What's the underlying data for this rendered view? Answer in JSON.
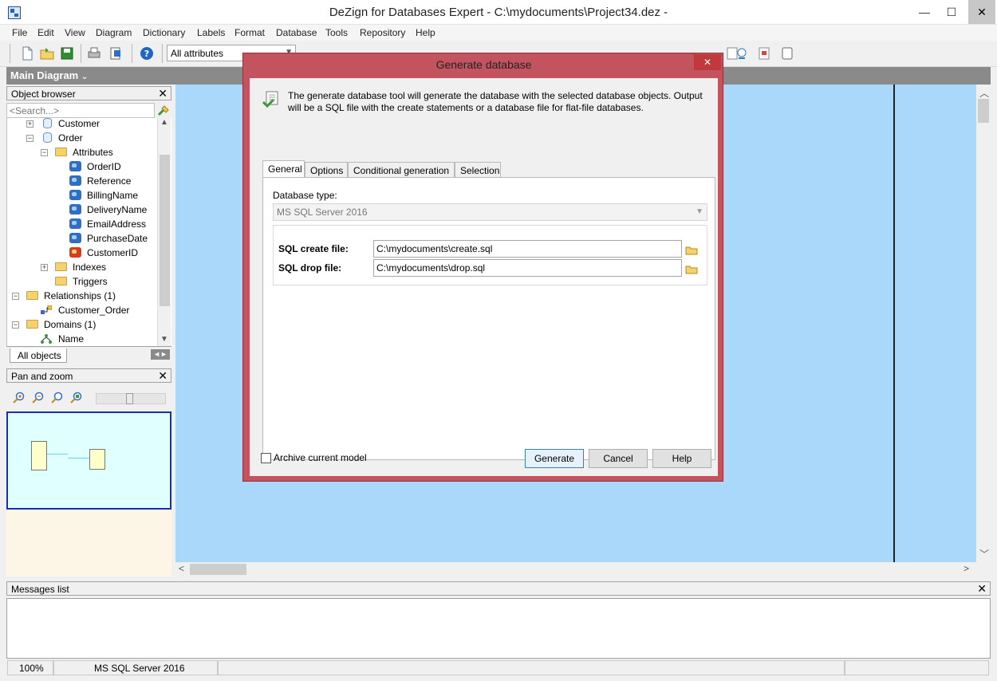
{
  "window": {
    "title": "DeZign for Databases Expert - C:\\mydocuments\\Project34.dez -",
    "minimize": "—",
    "maximize": "☐",
    "close": "✕"
  },
  "menubar": [
    "File",
    "Edit",
    "View",
    "Diagram",
    "Dictionary",
    "Labels",
    "Format",
    "Database",
    "Tools",
    "Repository",
    "Help"
  ],
  "toolbar": {
    "attributes_select": "All attributes"
  },
  "diagram": {
    "title": "Main Diagram",
    "title_arrow": "⌄"
  },
  "object_browser": {
    "title": "Object browser",
    "close": "✕",
    "search_placeholder": "<Search...>",
    "tree": [
      {
        "label": "Customer",
        "type": "table",
        "expander": "+"
      },
      {
        "label": "Order",
        "type": "table",
        "expander": "−"
      },
      {
        "label": "Attributes",
        "type": "folder",
        "expander": "−"
      },
      {
        "label": "OrderID",
        "type": "attribute"
      },
      {
        "label": "Reference",
        "type": "attribute"
      },
      {
        "label": "BillingName",
        "type": "attribute"
      },
      {
        "label": "DeliveryName",
        "type": "attribute"
      },
      {
        "label": "EmailAddress",
        "type": "attribute"
      },
      {
        "label": "PurchaseDate",
        "type": "attribute"
      },
      {
        "label": "CustomerID",
        "type": "foreign-key"
      },
      {
        "label": "Indexes",
        "type": "folder",
        "expander": "+"
      },
      {
        "label": "Triggers",
        "type": "folder"
      },
      {
        "label": "Relationships (1)",
        "type": "folder",
        "expander": "−"
      },
      {
        "label": "Customer_Order",
        "type": "relationship"
      },
      {
        "label": "Domains (1)",
        "type": "folder",
        "expander": "−"
      },
      {
        "label": "Name",
        "type": "domain"
      }
    ],
    "tab_label": "All objects",
    "nav": "◄►"
  },
  "pan_zoom": {
    "title": "Pan and zoom",
    "close": "✕",
    "tools": [
      "zoom-in-icon",
      "zoom-out-icon",
      "zoom-fit-icon",
      "zoom-actual-icon"
    ]
  },
  "messages": {
    "title": "Messages list",
    "close": "✕"
  },
  "statusbar": {
    "zoom": "100%",
    "database": "MS SQL Server 2016"
  },
  "dialog": {
    "title": "Generate database",
    "close": "✕",
    "description": "The generate database tool will generate the database with the selected database objects. Output will be a SQL file with the create statements or a database file for flat-file databases.",
    "tabs": [
      "General",
      "Options",
      "Conditional generation",
      "Selection"
    ],
    "active_tab": "General",
    "database_type_label": "Database type:",
    "database_type_value": "MS SQL Server 2016",
    "sql_create_label": "SQL create file:",
    "sql_create_value": "C:\\mydocuments\\create.sql",
    "sql_drop_label": "SQL drop file:",
    "sql_drop_value": "C:\\mydocuments\\drop.sql",
    "archive_label": "Archive current model",
    "archive_checked": false,
    "buttons": {
      "generate": "Generate",
      "cancel": "Cancel",
      "help": "Help"
    }
  },
  "colors": {
    "dialog_frame": "#c3545f",
    "canvas": "#aad8fa",
    "pan_view": "#e0ffff"
  }
}
